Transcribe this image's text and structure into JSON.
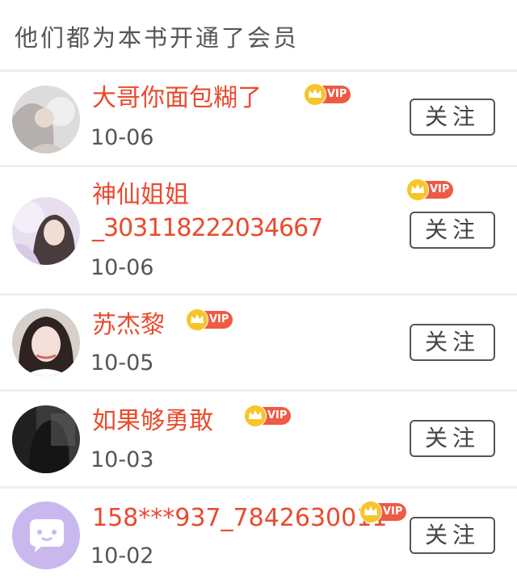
{
  "header": {
    "title": "他们都为本书开通了会员"
  },
  "vip_label": "VIP",
  "follow_label": "关注",
  "members": [
    {
      "name": "大哥你面包糊了",
      "date": "10-06",
      "vip": true
    },
    {
      "name_line1": "神仙姐姐",
      "name_line2": "_303118222034667",
      "date": "10-06",
      "vip": true
    },
    {
      "name": "苏杰黎",
      "date": "10-05",
      "vip": true
    },
    {
      "name": "如果够勇敢",
      "date": "10-03",
      "vip": true
    },
    {
      "name": "158***937_7842630011",
      "date": "10-02",
      "vip": true
    }
  ],
  "colors": {
    "name": "#ea4a2e",
    "vip_badge": "#ee5a45",
    "crown": "#f7c52a",
    "separator": "#eeeeee"
  }
}
